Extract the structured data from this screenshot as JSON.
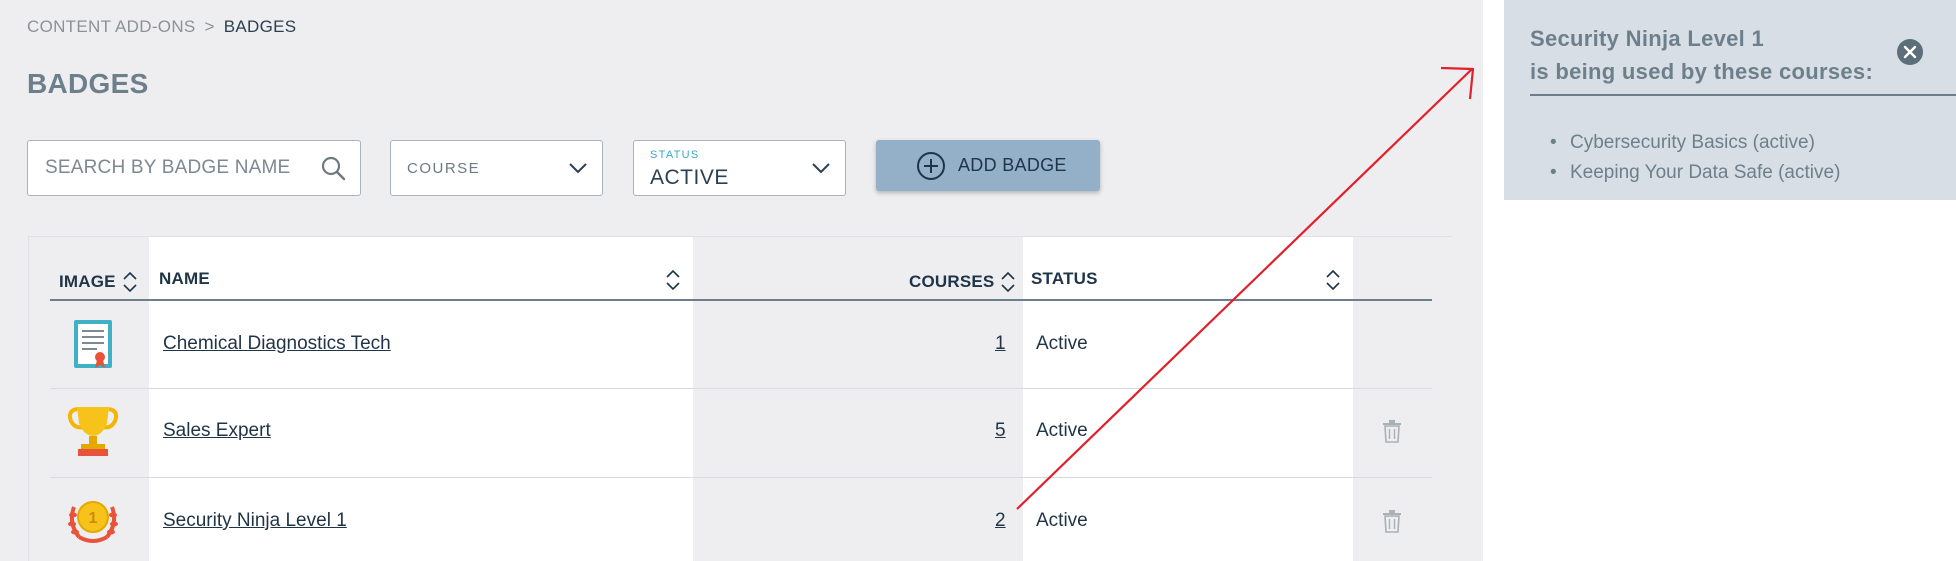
{
  "breadcrumb": {
    "parent": "CONTENT ADD-ONS",
    "separator": ">",
    "current": "BADGES"
  },
  "page_title": "BADGES",
  "filters": {
    "search_placeholder": "SEARCH BY BADGE NAME",
    "course_label": "COURSE",
    "status_label": "STATUS",
    "status_value": "ACTIVE"
  },
  "add_button": {
    "label": "ADD BADGE",
    "icon": "plus-circle-icon"
  },
  "table": {
    "columns": {
      "image": "IMAGE",
      "name": "NAME",
      "courses": "COURSES",
      "status": "STATUS"
    },
    "rows": [
      {
        "icon": "certificate-icon",
        "name": "Chemical Diagnostics Tech",
        "courses": "1",
        "status": "Active",
        "deletable": false
      },
      {
        "icon": "trophy-icon",
        "name": "Sales Expert",
        "courses": "5",
        "status": "Active",
        "deletable": true
      },
      {
        "icon": "gold-medal-icon",
        "name": "Security Ninja Level 1",
        "courses": "2",
        "status": "Active",
        "deletable": true
      }
    ]
  },
  "popup": {
    "title_line1": "Security Ninja Level 1",
    "title_line2": "is being used by these courses:",
    "items": [
      "Cybersecurity Basics (active)",
      "Keeping Your Data Safe (active)"
    ]
  },
  "colors": {
    "main_bg": "#eeeef0",
    "accent_button": "#94afc8",
    "popup_bg": "#d7dee5",
    "annotation": "#e0202a",
    "status_label": "#3aa6c9"
  }
}
